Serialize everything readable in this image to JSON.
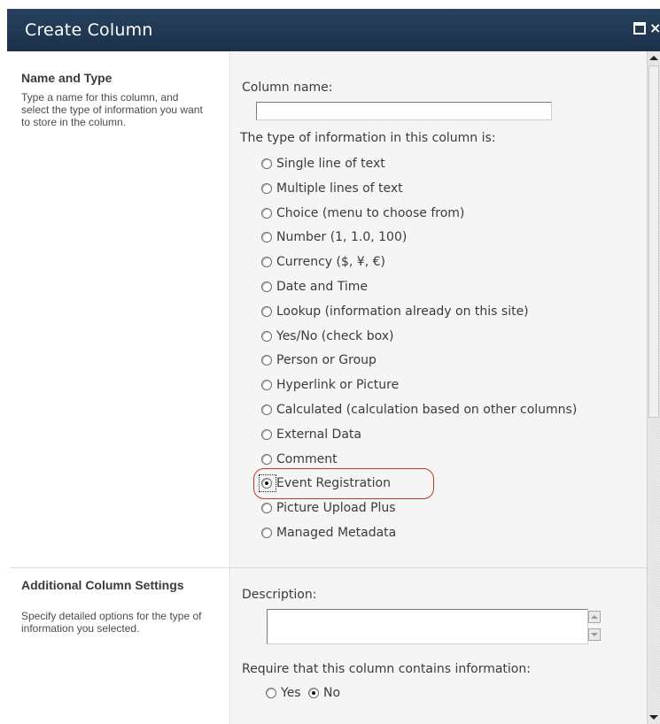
{
  "dialog": {
    "title": "Create Column",
    "maximize_label": "",
    "close_label": "×"
  },
  "name_type": {
    "heading": "Name and Type",
    "description": "Type a name for this column, and select the type of information you want to store in the column.",
    "column_name_label": "Column name:",
    "column_name_value": "",
    "type_label": "The type of information in this column is:",
    "types": [
      "Single line of text",
      "Multiple lines of text",
      "Choice (menu to choose from)",
      "Number (1, 1.0, 100)",
      "Currency ($, ¥, €)",
      "Date and Time",
      "Lookup (information already on this site)",
      "Yes/No (check box)",
      "Person or Group",
      "Hyperlink or Picture",
      "Calculated (calculation based on other columns)",
      "External Data",
      "Comment",
      "Event Registration",
      "Picture Upload Plus",
      "Managed Metadata"
    ],
    "selected_type": "Event Registration"
  },
  "additional": {
    "heading": "Additional Column Settings",
    "description": "Specify detailed options for the type of information you selected.",
    "description_field_label": "Description:",
    "description_value": "",
    "require_label": "Require that this column contains information:",
    "require_yes": "Yes",
    "require_no": "No",
    "require_selected": "No"
  },
  "colors": {
    "titlebar": "#1b3149",
    "highlight": "#c0392b",
    "right_panel": "#f5f5f5"
  }
}
